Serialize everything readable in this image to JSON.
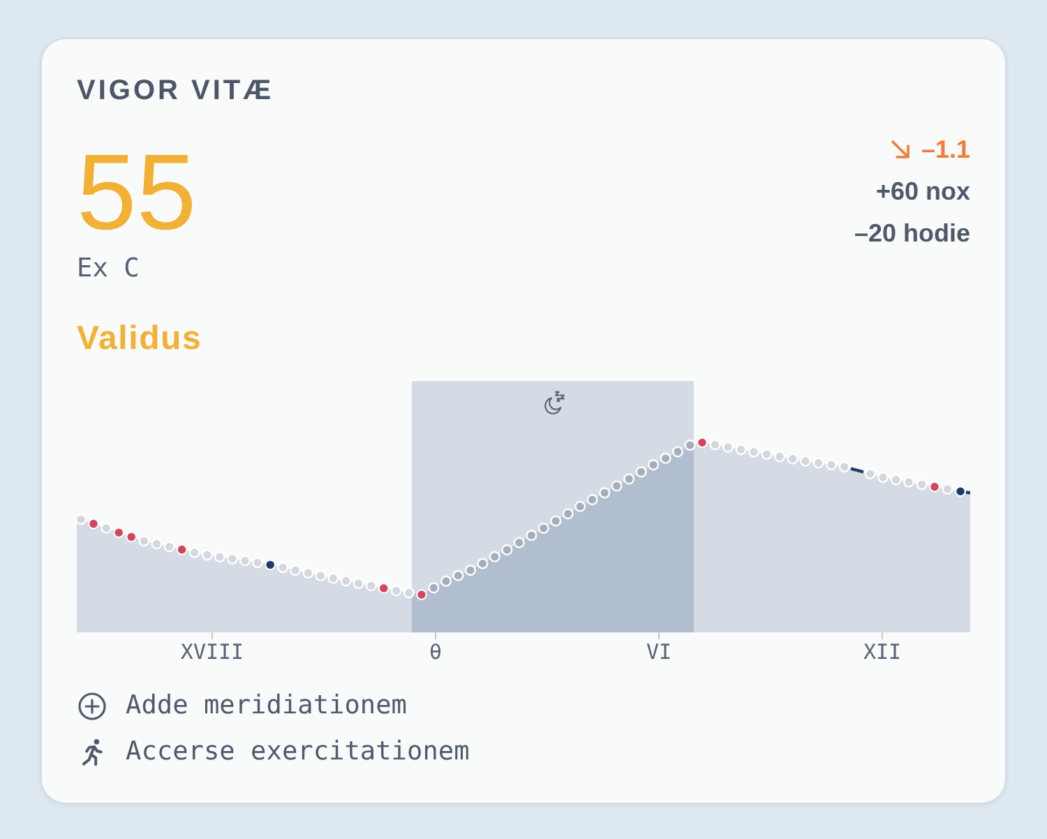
{
  "title": "VIGOR VITÆ",
  "score": {
    "value": "55",
    "scale": "Ex C",
    "rating": "Validus"
  },
  "trend": {
    "rising": false,
    "change": "–1.1",
    "details": [
      "+60 nox",
      "–20 hodie"
    ]
  },
  "chart": {
    "x_labels": [
      "XVIII",
      "θ",
      "VI",
      "XII"
    ]
  },
  "actions": [
    {
      "kind": "add",
      "label": "Adde meridiationem"
    },
    {
      "kind": "workout",
      "label": "Accerse exercitationem"
    }
  ]
}
